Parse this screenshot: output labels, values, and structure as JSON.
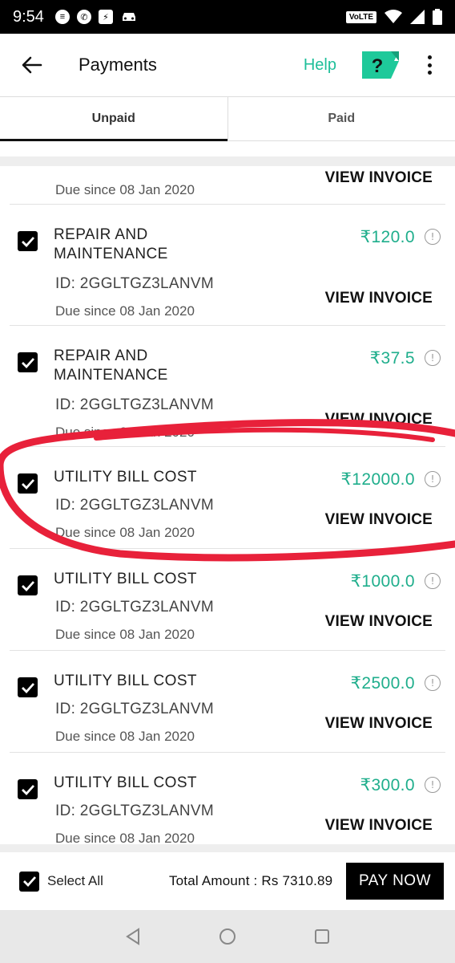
{
  "status_bar": {
    "time": "9:54",
    "network": "VoLTE"
  },
  "app_bar": {
    "title": "Payments",
    "help_label": "Help",
    "help_icon_glyph": "?"
  },
  "tabs": [
    {
      "label": "Unpaid",
      "active": true
    },
    {
      "label": "Paid",
      "active": false
    }
  ],
  "currency_symbol": "₹",
  "bills": [
    {
      "name": "",
      "id": "",
      "amount": "",
      "due": "Due since 08 Jan 2020",
      "invoice_label": "VIEW INVOICE",
      "checked": true
    },
    {
      "name": "REPAIR AND MAINTENANCE",
      "id": "ID: 2GGLTGZ3LANVM",
      "amount": "120.0",
      "due": "Due since 08 Jan 2020",
      "invoice_label": "VIEW INVOICE",
      "checked": true
    },
    {
      "name": "REPAIR AND MAINTENANCE",
      "id": "ID: 2GGLTGZ3LANVM",
      "amount": "37.5",
      "due": "Due since 08 Jan 2020",
      "invoice_label": "VIEW INVOICE",
      "checked": true
    },
    {
      "name": "UTILITY BILL COST",
      "id": "ID: 2GGLTGZ3LANVM",
      "amount": "12000.0",
      "due": "Due since 08 Jan 2020",
      "invoice_label": "VIEW INVOICE",
      "checked": true
    },
    {
      "name": "UTILITY BILL COST",
      "id": "ID: 2GGLTGZ3LANVM",
      "amount": "1000.0",
      "due": "Due since 08 Jan 2020",
      "invoice_label": "VIEW INVOICE",
      "checked": true
    },
    {
      "name": "UTILITY BILL COST",
      "id": "ID: 2GGLTGZ3LANVM",
      "amount": "2500.0",
      "due": "Due since 08 Jan 2020",
      "invoice_label": "VIEW INVOICE",
      "checked": true
    },
    {
      "name": "UTILITY BILL COST",
      "id": "ID: 2GGLTGZ3LANVM",
      "amount": "300.0",
      "due": "Due since 08 Jan 2020",
      "invoice_label": "VIEW INVOICE",
      "checked": true
    }
  ],
  "footer": {
    "select_all_label": "Select All",
    "total_label": "Total Amount : Rs 7310.89",
    "pay_button": "PAY NOW"
  },
  "colors": {
    "accent": "#1fbf9a",
    "annotation": "#e8213a"
  }
}
